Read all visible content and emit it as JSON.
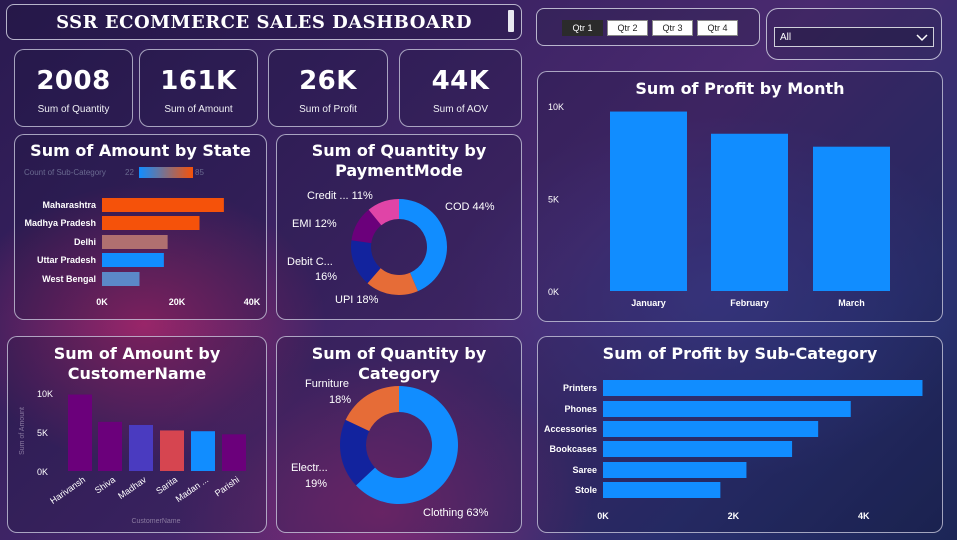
{
  "header": {
    "title": "SSR ECOMMERCE SALES DASHBOARD"
  },
  "slicer": {
    "quarters": [
      "Qtr 1",
      "Qtr 2",
      "Qtr 3",
      "Qtr 4"
    ],
    "selected": "Qtr 1",
    "dropdown_value": "All"
  },
  "kpis": [
    {
      "value": "2008",
      "label": "Sum of Quantity"
    },
    {
      "value": "161K",
      "label": "Sum of Amount"
    },
    {
      "value": "26K",
      "label": "Sum of Profit"
    },
    {
      "value": "44K",
      "label": "Sum of AOV"
    }
  ],
  "colors": {
    "blue": "#118DFF",
    "orange_red": "#F5520A",
    "dark_purple": "#6B007B",
    "violet": "#8A2BE2",
    "pink": "#E044A7",
    "orange": "#E66C37",
    "navy": "#12239E",
    "coral": "#D64550",
    "rose": "#B07070",
    "steel": "#5B88C8"
  },
  "chart_data": [
    {
      "id": "amount_by_state",
      "type": "bar",
      "orientation": "horizontal",
      "title": "Sum of Amount by State",
      "legend": {
        "title": "Count of Sub-Category",
        "min": "22",
        "max": "85"
      },
      "categories": [
        "Maharashtra",
        "Madhya Pradesh",
        "Delhi",
        "Uttar Pradesh",
        "West Bengal"
      ],
      "values": [
        32500,
        26000,
        17500,
        16500,
        10000
      ],
      "bar_colors": [
        "#F5520A",
        "#F5520A",
        "#B07070",
        "#118DFF",
        "#5B88C8"
      ],
      "xticks": [
        "0K",
        "20K",
        "40K"
      ],
      "xlim": [
        0,
        40000
      ]
    },
    {
      "id": "quantity_by_paymentmode",
      "type": "pie",
      "donut": true,
      "title": "Sum of Quantity by PaymentMode",
      "labels": [
        "COD 44%",
        "UPI 18%",
        "Debit C... 16%",
        "EMI 12%",
        "Credit ... 11%"
      ],
      "values": [
        44,
        18,
        16,
        12,
        11
      ],
      "slice_colors": [
        "#118DFF",
        "#E66C37",
        "#12239E",
        "#6B007B",
        "#E044A7"
      ]
    },
    {
      "id": "profit_by_month",
      "type": "bar",
      "title": "Sum of Profit by Month",
      "categories": [
        "January",
        "February",
        "March"
      ],
      "values": [
        9700,
        8500,
        7800
      ],
      "yticks": [
        "0K",
        "5K",
        "10K"
      ],
      "ylim": [
        0,
        10000
      ]
    },
    {
      "id": "amount_by_customername",
      "type": "bar",
      "title": "Sum of Amount by CustomerName",
      "ylabel": "Sum of Amount",
      "xlabel": "CustomerName",
      "categories": [
        "Harivansh",
        "Shiva",
        "Madhav",
        "Sarita",
        "Madan ...",
        "Parishi"
      ],
      "values": [
        9800,
        6300,
        5900,
        5200,
        5100,
        4700
      ],
      "bar_colors": [
        "#6B007B",
        "#6B007B",
        "#4A3BC0",
        "#D64550",
        "#118DFF",
        "#6B007B"
      ],
      "yticks": [
        "0K",
        "5K",
        "10K"
      ],
      "ylim": [
        0,
        10000
      ]
    },
    {
      "id": "quantity_by_category",
      "type": "pie",
      "donut": true,
      "title": "Sum of Quantity by Category",
      "labels": [
        "Clothing 63%",
        "Electr... 19%",
        "Furniture 18%"
      ],
      "values": [
        63,
        19,
        18
      ],
      "slice_colors": [
        "#118DFF",
        "#12239E",
        "#E66C37"
      ]
    },
    {
      "id": "profit_by_subcategory",
      "type": "bar",
      "orientation": "horizontal",
      "title": "Sum of Profit by Sub-Category",
      "categories": [
        "Printers",
        "Phones",
        "Accessories",
        "Bookcases",
        "Saree",
        "Stole"
      ],
      "values": [
        4900,
        3800,
        3300,
        2900,
        2200,
        1800
      ],
      "xticks": [
        "0K",
        "2K",
        "4K"
      ],
      "xlim": [
        0,
        5000
      ]
    }
  ]
}
